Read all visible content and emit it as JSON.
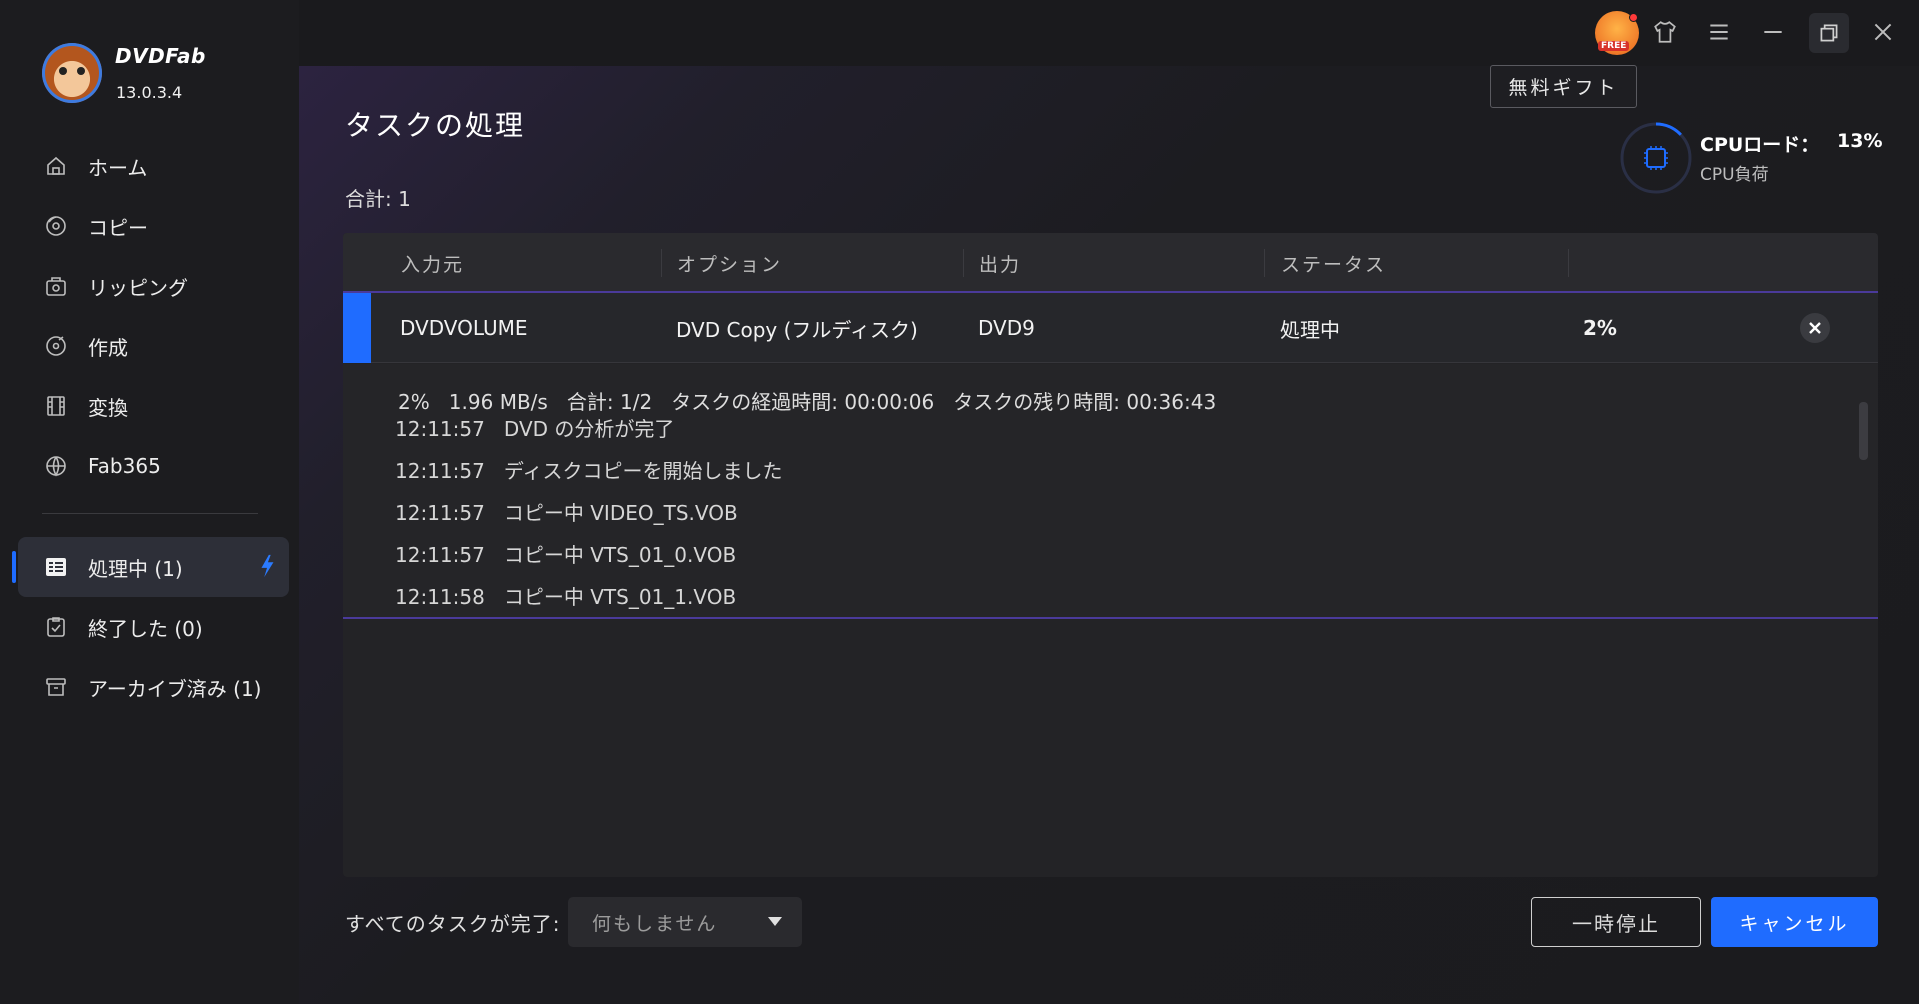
{
  "app": {
    "brand": "DVDFab",
    "version": "13.0.3.4"
  },
  "sidebar": {
    "nav": [
      {
        "label": "ホーム",
        "icon": "home-icon"
      },
      {
        "label": "コピー",
        "icon": "copy-icon"
      },
      {
        "label": "リッピング",
        "icon": "ripping-icon"
      },
      {
        "label": "作成",
        "icon": "create-icon"
      },
      {
        "label": "変換",
        "icon": "convert-icon"
      },
      {
        "label": "Fab365",
        "icon": "fab365-icon"
      }
    ],
    "tasks": [
      {
        "label": "処理中 (1)",
        "icon": "processing-icon",
        "active": true
      },
      {
        "label": "終了した (0)",
        "icon": "finished-icon",
        "active": false
      },
      {
        "label": "アーカイブ済み (1)",
        "icon": "archive-icon",
        "active": false
      }
    ]
  },
  "topbar": {
    "gift_badge": "FREE",
    "gift_tooltip": "無料ギフト",
    "icons": [
      "gift-icon",
      "skin-icon",
      "menu-icon",
      "minimize-icon",
      "restore-icon",
      "close-icon"
    ]
  },
  "main": {
    "title": "タスクの処理",
    "total": "合計: 1",
    "cpu": {
      "label": "CPUロード：",
      "value": "13%",
      "sub": "CPU負荷",
      "load_fraction": 0.13
    },
    "table": {
      "headers": [
        "入力元",
        "オプション",
        "出力",
        "ステータス"
      ],
      "row": {
        "source": "DVDVOLUME",
        "option": "DVD Copy (フルディスク)",
        "output": "DVD9",
        "status": "処理中",
        "progress": "2%"
      }
    },
    "detail": {
      "stats": "2%   1.96 MB/s   合計: 1/2   タスクの経過時間: 00:00:06   タスクの残り時間: 00:36:43",
      "log": [
        "12:11:57   DVD の分析が完了",
        "12:11:57   ディスクコピーを開始しました",
        "12:11:57   コピー中 VIDEO_TS.VOB",
        "12:11:57   コピー中 VTS_01_0.VOB",
        "12:11:58   コピー中 VTS_01_1.VOB"
      ]
    },
    "footer": {
      "when_done_label": "すべてのタスクが完了:",
      "when_done_value": "何もしません",
      "pause": "一時停止",
      "cancel": "キャンセル"
    }
  },
  "colors": {
    "accent": "#1f6cff",
    "sidebar_bg": "#1c1c1f",
    "row_border": "#4a3a9a"
  }
}
